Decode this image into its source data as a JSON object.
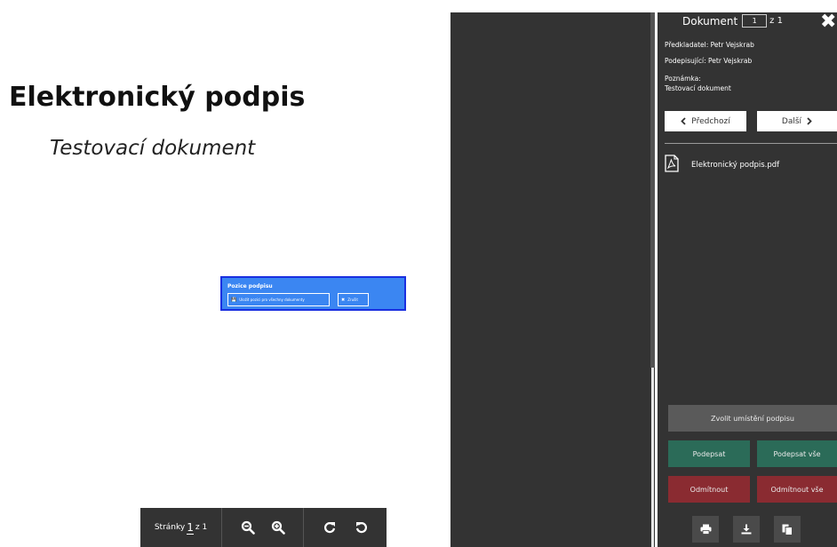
{
  "document_preview": {
    "title": "Elektronický podpis",
    "subtitle": "Testovací dokument"
  },
  "signature_box": {
    "title": "Pozice podpisu",
    "save_label": "Uložit pozici pro všechny dokumenty",
    "cancel_label": "Zrušit"
  },
  "viewer_toolbar": {
    "pages_label": "Stránky",
    "page_current": "1",
    "page_of": "z 1"
  },
  "sidebar": {
    "doc_label": "Dokument",
    "doc_current": "1",
    "doc_total": "z 1",
    "submitter": "Předkladatel: Petr Vejskrab",
    "signer": "Podepisující: Petr Vejskrab",
    "note_label": "Poznámka:",
    "note_value": "Testovací dokument",
    "prev_label": "Předchozí",
    "next_label": "Další",
    "file_name": "Elektronický podpis.pdf",
    "place_label": "Zvolit umístění podpisu",
    "sign_label": "Podepsat",
    "sign_all_label": "Podepsat vše",
    "reject_label": "Odmítnout",
    "reject_all_label": "Odmítnout vše"
  },
  "colors": {
    "panel": "#333333",
    "sign_green": "#2b6b58",
    "reject_red": "#8a2b31",
    "signature_blue": "#3b86f2"
  }
}
